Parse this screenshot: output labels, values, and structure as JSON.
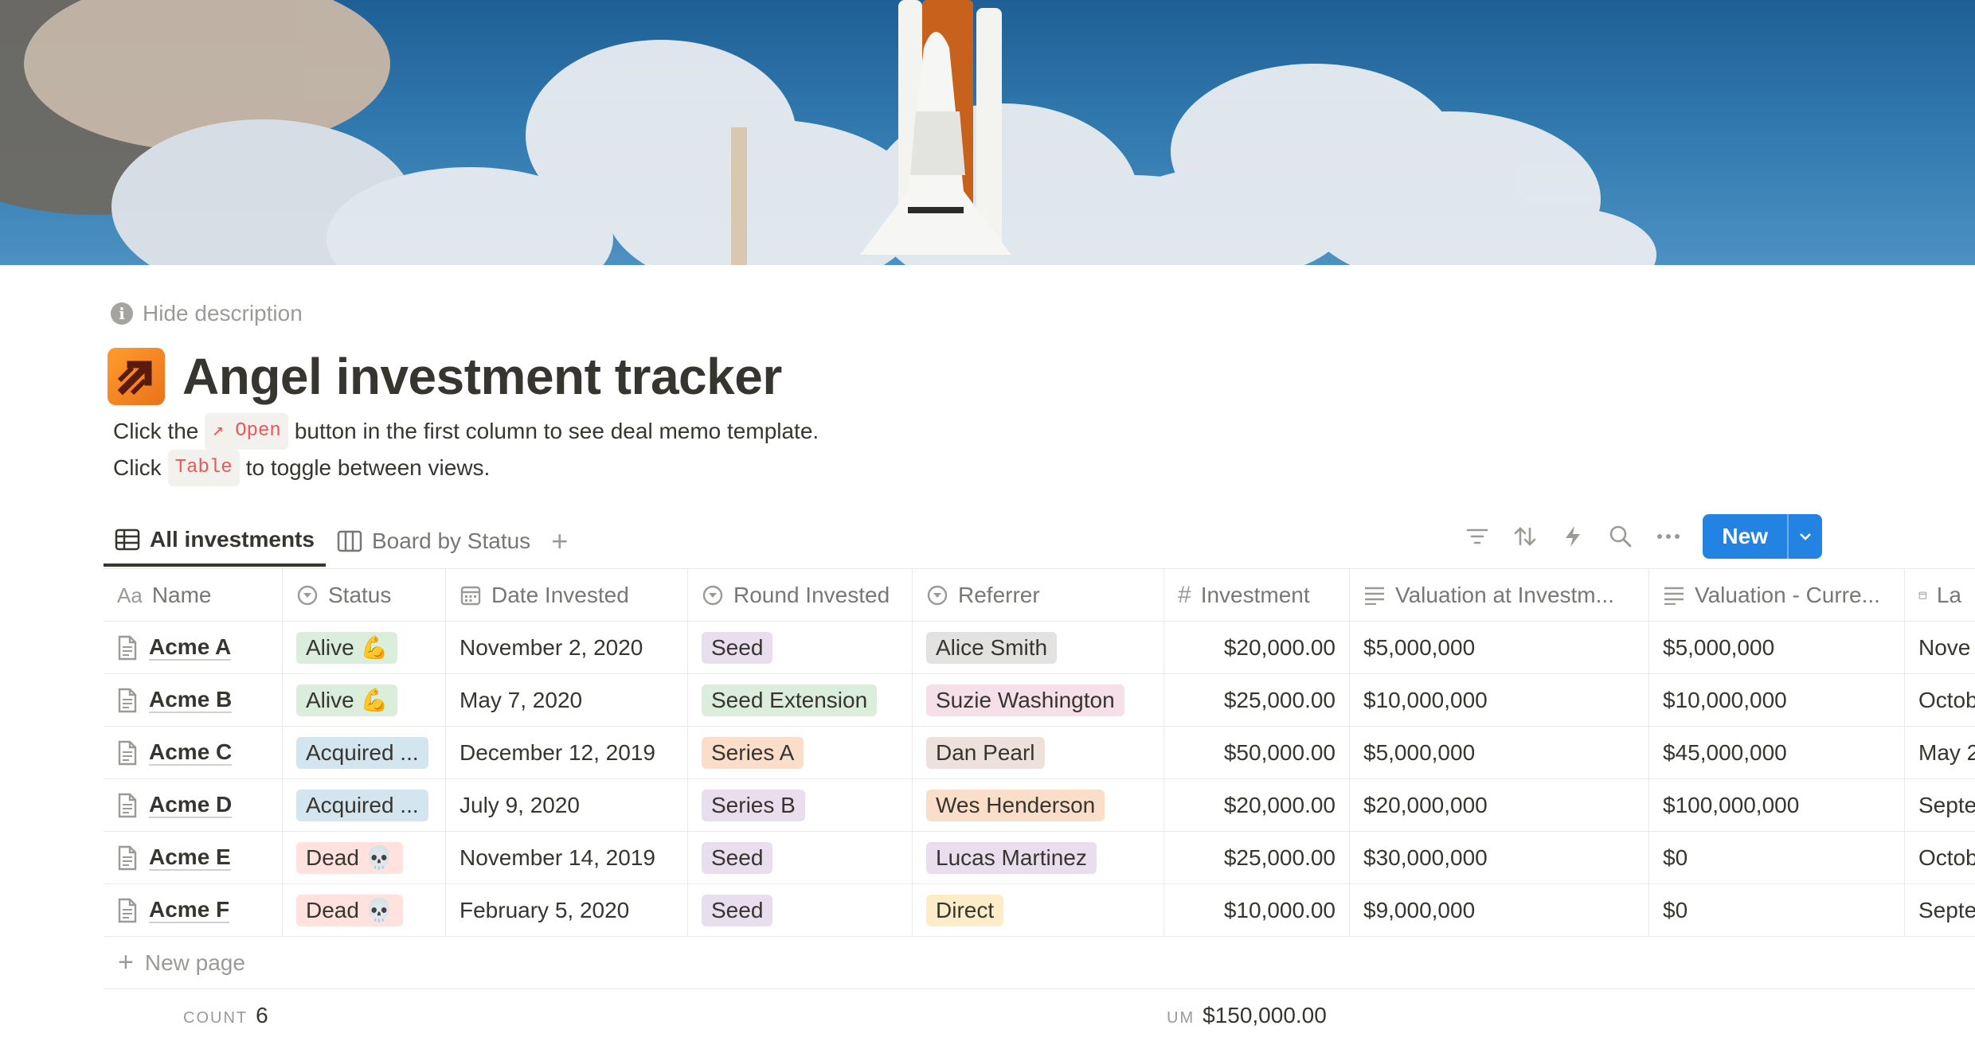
{
  "colors": {
    "accent": "#2383e2",
    "text": "#37352f",
    "muted": "#787774",
    "code_red": "#eb5757"
  },
  "header": {
    "hide_description": "Hide description",
    "title": "Angel investment tracker",
    "description": {
      "line1_a": "Click the",
      "line1_code": "↗ Open",
      "line1_b": "button in the first column to see deal memo template.",
      "line2_a": "Click",
      "line2_code": "Table",
      "line2_b": "to toggle between views."
    }
  },
  "tabs": [
    {
      "label": "All investments",
      "icon": "table-icon",
      "active": true
    },
    {
      "label": "Board by Status",
      "icon": "board-icon",
      "active": false
    }
  ],
  "toolbar": {
    "icons": [
      "filter-icon",
      "sort-icon",
      "lightning-icon",
      "search-icon",
      "more-icon"
    ],
    "new_label": "New"
  },
  "table": {
    "columns": [
      {
        "label": "Name",
        "icon": "text-icon"
      },
      {
        "label": "Status",
        "icon": "select-icon"
      },
      {
        "label": "Date Invested",
        "icon": "calendar-icon"
      },
      {
        "label": "Round Invested",
        "icon": "select-icon"
      },
      {
        "label": "Referrer",
        "icon": "select-icon"
      },
      {
        "label": "Investment",
        "icon": "number-icon"
      },
      {
        "label": "Valuation at Investm...",
        "icon": "lines-icon"
      },
      {
        "label": "Valuation - Curre...",
        "icon": "lines-icon"
      },
      {
        "label": "La",
        "icon": "calendar-icon"
      }
    ],
    "rows": [
      {
        "name": "Acme A",
        "status": "Alive 💪",
        "status_bg": "#dbeddb",
        "date": "November 2, 2020",
        "round": "Seed",
        "round_bg": "#e8deee",
        "referrer": "Alice Smith",
        "referrer_bg": "#e3e2e0",
        "investment": "$20,000.00",
        "val_inv": "$5,000,000",
        "val_cur": "$5,000,000",
        "last": "Nove"
      },
      {
        "name": "Acme B",
        "status": "Alive 💪",
        "status_bg": "#dbeddb",
        "date": "May 7, 2020",
        "round": "Seed Extension",
        "round_bg": "#dbeddb",
        "referrer": "Suzie Washington",
        "referrer_bg": "#f5e0e9",
        "investment": "$25,000.00",
        "val_inv": "$10,000,000",
        "val_cur": "$10,000,000",
        "last": "Octob"
      },
      {
        "name": "Acme C",
        "status": "Acquired ...",
        "status_bg": "#d3e5ef",
        "date": "December 12, 2019",
        "round": "Series A",
        "round_bg": "#fadec9",
        "referrer": "Dan Pearl",
        "referrer_bg": "#eee0da",
        "investment": "$50,000.00",
        "val_inv": "$5,000,000",
        "val_cur": "$45,000,000",
        "last": "May 2"
      },
      {
        "name": "Acme D",
        "status": "Acquired ...",
        "status_bg": "#d3e5ef",
        "date": "July 9, 2020",
        "round": "Series B",
        "round_bg": "#e8deee",
        "referrer": "Wes Henderson",
        "referrer_bg": "#fadec9",
        "investment": "$20,000.00",
        "val_inv": "$20,000,000",
        "val_cur": "$100,000,000",
        "last": "Septe"
      },
      {
        "name": "Acme E",
        "status": "Dead 💀",
        "status_bg": "#ffe2dd",
        "date": "November 14, 2019",
        "round": "Seed",
        "round_bg": "#e8deee",
        "referrer": "Lucas Martinez",
        "referrer_bg": "#e8deee",
        "investment": "$25,000.00",
        "val_inv": "$30,000,000",
        "val_cur": "$0",
        "last": "Octob"
      },
      {
        "name": "Acme F",
        "status": "Dead 💀",
        "status_bg": "#ffe2dd",
        "date": "February 5, 2020",
        "round": "Seed",
        "round_bg": "#e8deee",
        "referrer": "Direct",
        "referrer_bg": "#fdecc8",
        "investment": "$10,000.00",
        "val_inv": "$9,000,000",
        "val_cur": "$0",
        "last": "Septe"
      }
    ],
    "new_page": "New page",
    "footer": {
      "count_label": "COUNT",
      "count_value": "6",
      "sum_label": "UM",
      "sum_value": "$150,000.00"
    }
  }
}
